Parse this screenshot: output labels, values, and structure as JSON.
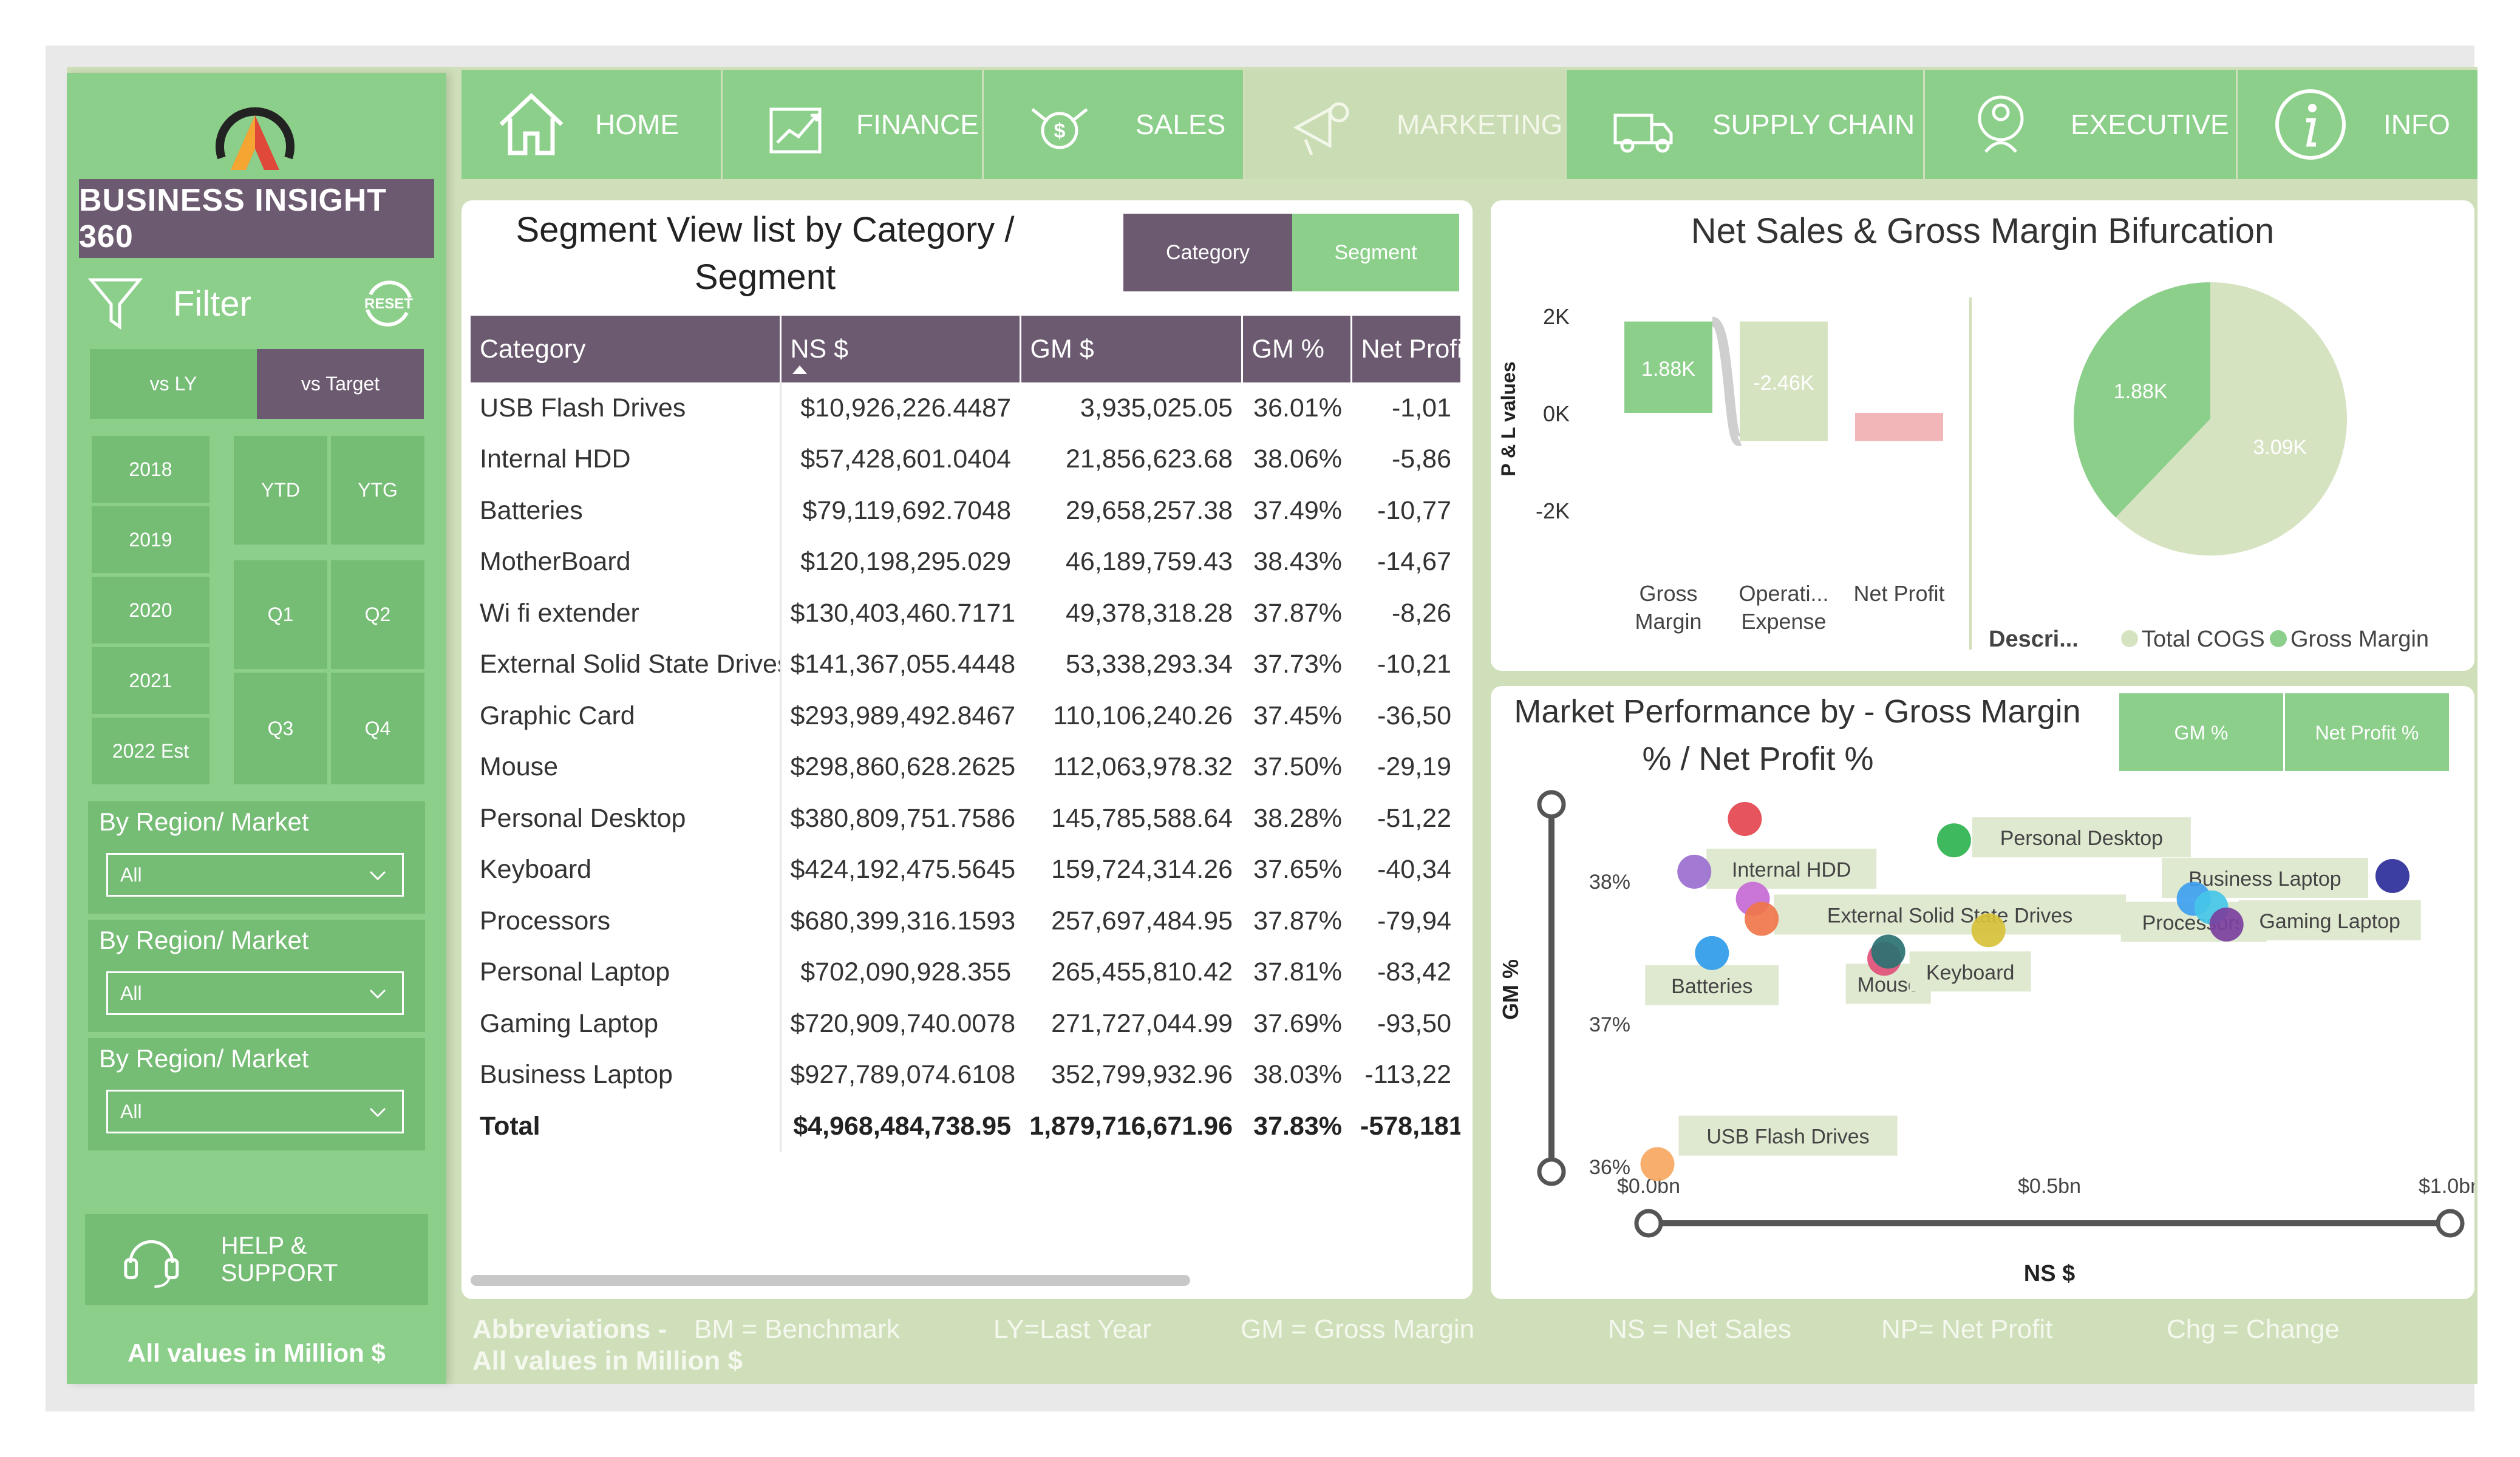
{
  "brand": {
    "title": "BUSINESS INSIGHT 360"
  },
  "filter": {
    "label": "Filter",
    "reset": "RESET"
  },
  "compare": {
    "vs_ly": "vs LY",
    "vs_target": "vs Target"
  },
  "years": [
    "2018",
    "2019",
    "2020",
    "2021",
    "2022 Est"
  ],
  "periods": {
    "ytd": "YTD",
    "ytg": "YTG",
    "q1": "Q1",
    "q2": "Q2",
    "q3": "Q3",
    "q4": "Q4"
  },
  "regions": [
    {
      "title": "By Region/ Market",
      "value": "All"
    },
    {
      "title": "By Region/ Market",
      "value": "All"
    },
    {
      "title": "By Region/ Market",
      "value": "All"
    }
  ],
  "help": {
    "label": "HELP & SUPPORT"
  },
  "units_note": "All values in Million $",
  "nav": [
    {
      "label": "HOME",
      "icon": "home-icon"
    },
    {
      "label": "FINANCE",
      "icon": "finance-icon"
    },
    {
      "label": "SALES",
      "icon": "sales-icon"
    },
    {
      "label": "MARKETING",
      "icon": "marketing-icon",
      "active": true
    },
    {
      "label": "SUPPLY CHAIN",
      "icon": "supply-chain-icon"
    },
    {
      "label": "EXECUTIVE",
      "icon": "executive-icon"
    },
    {
      "label": "INFO",
      "icon": "info-icon"
    }
  ],
  "segment_table": {
    "title": "Segment View list by Category / Segment",
    "toggle_category": "Category",
    "toggle_segment": "Segment",
    "columns": [
      "Category",
      "NS $",
      "GM $",
      "GM %",
      "Net Profi"
    ],
    "rows": [
      [
        "USB Flash Drives",
        "$10,926,226.4487",
        "3,935,025.05",
        "36.01%",
        "-1,01"
      ],
      [
        "Internal HDD",
        "$57,428,601.0404",
        "21,856,623.68",
        "38.06%",
        "-5,86"
      ],
      [
        "Batteries",
        "$79,119,692.7048",
        "29,658,257.38",
        "37.49%",
        "-10,77"
      ],
      [
        "MotherBoard",
        "$120,198,295.029",
        "46,189,759.43",
        "38.43%",
        "-14,67"
      ],
      [
        "Wi fi extender",
        "$130,403,460.7171",
        "49,378,318.28",
        "37.87%",
        "-8,26"
      ],
      [
        "External Solid State Drives",
        "$141,367,055.4448",
        "53,338,293.34",
        "37.73%",
        "-10,21"
      ],
      [
        "Graphic Card",
        "$293,989,492.8467",
        "110,106,240.26",
        "37.45%",
        "-36,50"
      ],
      [
        "Mouse",
        "$298,860,628.2625",
        "112,063,978.32",
        "37.50%",
        "-29,19"
      ],
      [
        "Personal Desktop",
        "$380,809,751.7586",
        "145,785,588.64",
        "38.28%",
        "-51,22"
      ],
      [
        "Keyboard",
        "$424,192,475.5645",
        "159,724,314.26",
        "37.65%",
        "-40,34"
      ],
      [
        "Processors",
        "$680,399,316.1593",
        "257,697,484.95",
        "37.87%",
        "-79,94"
      ],
      [
        "Personal Laptop",
        "$702,090,928.355",
        "265,455,810.42",
        "37.81%",
        "-83,42"
      ],
      [
        "Gaming Laptop",
        "$720,909,740.0078",
        "271,727,044.99",
        "37.69%",
        "-93,50"
      ],
      [
        "Business Laptop",
        "$927,789,074.6108",
        "352,799,932.96",
        "38.03%",
        "-113,22"
      ]
    ],
    "total": [
      "Total",
      "$4,968,484,738.95",
      "1,879,716,671.96",
      "37.83%",
      "-578,181"
    ]
  },
  "chart_data": [
    {
      "type": "bar",
      "title": "Net Sales & Gross Margin Bifurcation",
      "subtype": "waterfall",
      "ylabel": "P & L values",
      "yticks": [
        "2K",
        "0K",
        "-2K"
      ],
      "ylim": [
        -2,
        2
      ],
      "categories": [
        "Gross Margin",
        "Operati... Expense",
        "Net Profit"
      ],
      "values": [
        1.88,
        -2.46,
        -0.58
      ],
      "labels": [
        "1.88K",
        "-2.46K",
        ""
      ],
      "colors": [
        "#8ccf8b",
        "#d6e3c1",
        "#f2b6b8"
      ]
    },
    {
      "type": "pie",
      "legend_title": "Descri...",
      "categories": [
        "Total COGS",
        "Gross Margin"
      ],
      "values": [
        3.09,
        1.88
      ],
      "labels": [
        "3.09K",
        "1.88K"
      ],
      "colors": [
        "#d6e3c1",
        "#8ccf8b"
      ]
    },
    {
      "type": "scatter",
      "title": "Market Performance by - Gross Margin % / Net Profit %",
      "toggle_gm": "GM %",
      "toggle_np": "Net Profit %",
      "xlabel": "NS $",
      "ylabel": "GM %",
      "xticks": [
        "$0.0bn",
        "$0.5bn",
        "$1.0bn"
      ],
      "yticks": [
        "38%",
        "37%",
        "36%"
      ],
      "xlim": [
        0,
        1.0
      ],
      "ylim": [
        36,
        38.6
      ],
      "points": [
        {
          "name": "USB Flash Drives",
          "x": 0.011,
          "y": 36.01,
          "color": "#f7a862",
          "label": "USB Flash Drives"
        },
        {
          "name": "Internal HDD",
          "x": 0.057,
          "y": 38.06,
          "color": "#9b6fcf",
          "label": "Internal HDD"
        },
        {
          "name": "Batteries",
          "x": 0.079,
          "y": 37.49,
          "color": "#2f9bea",
          "label": "Batteries"
        },
        {
          "name": "MotherBoard",
          "x": 0.12,
          "y": 38.43,
          "color": "#e4474f",
          "label": ""
        },
        {
          "name": "Wi fi extender",
          "x": 0.13,
          "y": 37.87,
          "color": "#c56ad6",
          "label": ""
        },
        {
          "name": "External Solid State Drives",
          "x": 0.141,
          "y": 37.73,
          "color": "#f0764a",
          "label": "External Solid State Drives"
        },
        {
          "name": "Graphic Card",
          "x": 0.294,
          "y": 37.45,
          "color": "#e0507a",
          "label": ""
        },
        {
          "name": "Mouse",
          "x": 0.299,
          "y": 37.5,
          "color": "#2a7272",
          "label": "Mouse"
        },
        {
          "name": "Personal Desktop",
          "x": 0.381,
          "y": 38.28,
          "color": "#2fb34f",
          "label": "Personal Desktop"
        },
        {
          "name": "Keyboard",
          "x": 0.424,
          "y": 37.65,
          "color": "#d7c13a",
          "label": "Keyboard"
        },
        {
          "name": "Processors",
          "x": 0.68,
          "y": 37.87,
          "color": "#3ea0f0",
          "label": "Processors"
        },
        {
          "name": "Personal Laptop",
          "x": 0.702,
          "y": 37.81,
          "color": "#45c6e8",
          "label": ""
        },
        {
          "name": "Gaming Laptop",
          "x": 0.721,
          "y": 37.69,
          "color": "#7b3fa0",
          "label": "Gaming Laptop"
        },
        {
          "name": "Business Laptop",
          "x": 0.928,
          "y": 38.03,
          "color": "#2b2f99",
          "label": "Business Laptop"
        }
      ]
    }
  ],
  "footer": {
    "abbr_label": "Abbreviations -",
    "items": [
      "BM = Benchmark",
      "LY=Last Year",
      "GM = Gross Margin",
      "NS = Net Sales",
      "NP= Net Profit",
      "Chg = Change"
    ],
    "all_values": "All values in Million $"
  }
}
